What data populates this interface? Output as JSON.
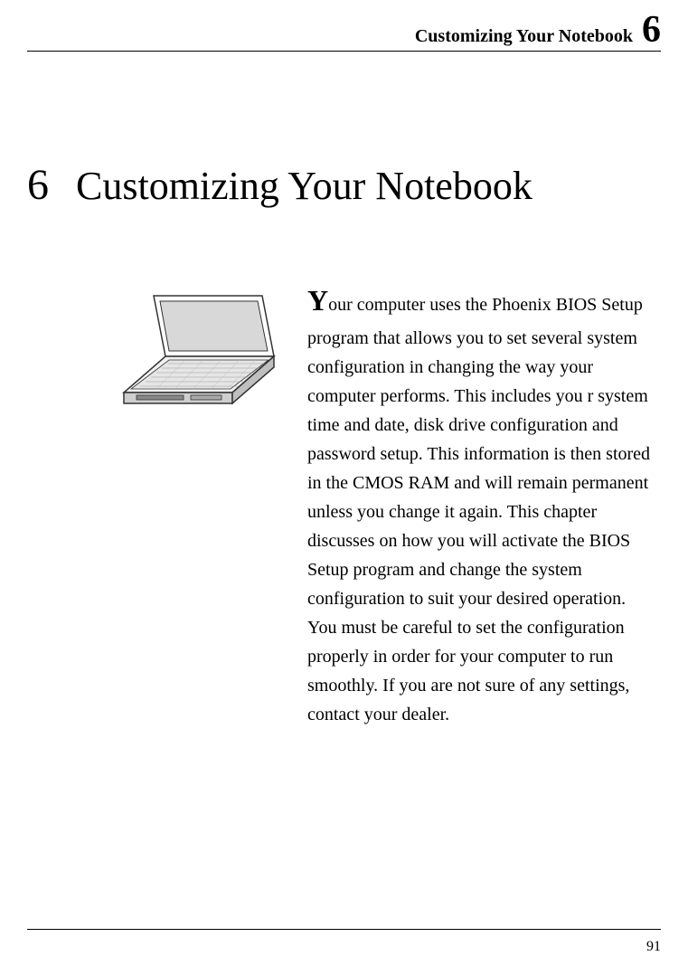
{
  "header": {
    "title": "Customizing Your Notebook",
    "chapter_big": "6"
  },
  "chapter": {
    "number": "6",
    "title": "Customizing Your Notebook"
  },
  "body": {
    "drop_cap": "Y",
    "text_after_dropcap": "our computer uses the Phoenix BIOS Setup program that allows you to set several system configuration in changing the way your computer performs. This includes you r system time and date, disk drive configuration and password setup. This information is then stored in the CMOS RAM and will remain permanent unless you change it again. This chapter discusses on how you will activate the BIOS Setup program and change the system configuration to suit your desired operation. You must be careful to set the configuration properly in order for your computer to run smoothly. If you are not sure of any settings, contact your dealer."
  },
  "footer": {
    "page_number": "91"
  }
}
